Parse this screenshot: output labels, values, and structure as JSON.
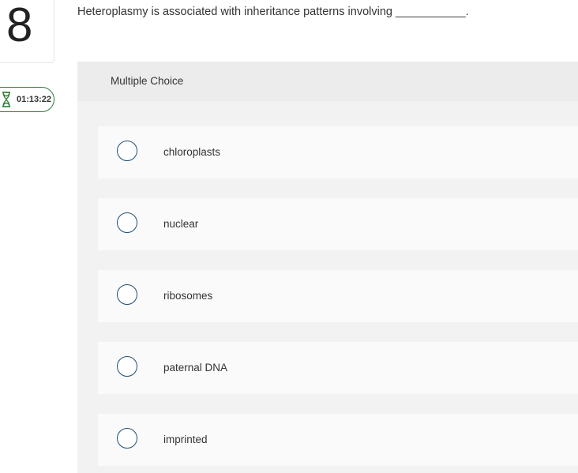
{
  "question": {
    "number": "8",
    "text": "Heteroplasmy is associated with inheritance patterns involving ___________."
  },
  "timer": {
    "icon": "hourglass-icon",
    "value": "01:13:22",
    "color": "#2f7d32"
  },
  "multiple_choice": {
    "label": "Multiple Choice",
    "options": [
      {
        "label": "chloroplasts"
      },
      {
        "label": "nuclear"
      },
      {
        "label": "ribosomes"
      },
      {
        "label": "paternal DNA"
      },
      {
        "label": "imprinted"
      }
    ]
  },
  "colors": {
    "radio_border": "#1f4e79",
    "panel_background": "#f2f2f2",
    "option_background": "#fafafa"
  }
}
